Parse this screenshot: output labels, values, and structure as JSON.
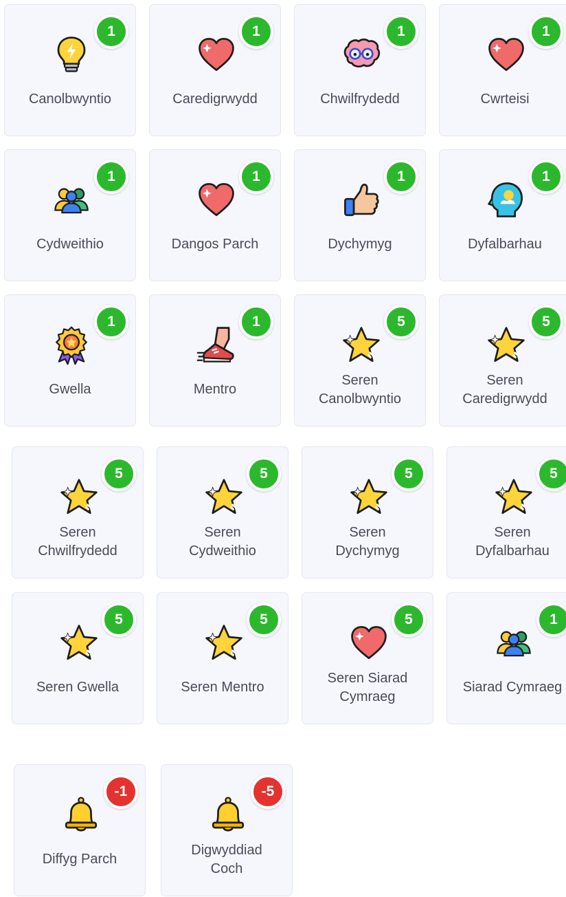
{
  "colors": {
    "positive_badge": "#2cb82c",
    "negative_badge": "#e4322f",
    "card_background": "#f6f7fc",
    "card_border": "#e4e6f0",
    "label_text": "#484c58"
  },
  "positive_skills": [
    {
      "label_lines": [
        "Canolbwyntio"
      ],
      "points": "1",
      "icon": "lightbulb-icon"
    },
    {
      "label_lines": [
        "Caredigrwydd"
      ],
      "points": "1",
      "icon": "heart-icon"
    },
    {
      "label_lines": [
        "Chwilfrydedd"
      ],
      "points": "1",
      "icon": "brain-with-glasses-icon"
    },
    {
      "label_lines": [
        "Cwrteisi"
      ],
      "points": "1",
      "icon": "heart-icon"
    },
    {
      "label_lines": [
        "Cydweithio"
      ],
      "points": "1",
      "icon": "people-group-icon"
    },
    {
      "label_lines": [
        "Dangos Parch"
      ],
      "points": "1",
      "icon": "heart-icon"
    },
    {
      "label_lines": [
        "Dychymyg"
      ],
      "points": "1",
      "icon": "thumbs-up-icon"
    },
    {
      "label_lines": [
        "Dyfalbarhau"
      ],
      "points": "1",
      "icon": "head-sunshine-icon"
    },
    {
      "label_lines": [
        "Gwella"
      ],
      "points": "1",
      "icon": "award-rosette-icon"
    },
    {
      "label_lines": [
        "Mentro"
      ],
      "points": "1",
      "icon": "running-shoe-icon"
    },
    {
      "label_lines": [
        "Seren",
        "Canolbwyntio"
      ],
      "points": "5",
      "icon": "star-icon"
    },
    {
      "label_lines": [
        "Seren",
        "Caredigrwydd"
      ],
      "points": "5",
      "icon": "star-icon"
    },
    {
      "label_lines": [
        "Seren",
        "Chwilfrydedd"
      ],
      "points": "5",
      "icon": "star-icon"
    },
    {
      "label_lines": [
        "Seren",
        "Cydweithio"
      ],
      "points": "5",
      "icon": "star-icon"
    },
    {
      "label_lines": [
        "Seren",
        "Dychymyg"
      ],
      "points": "5",
      "icon": "star-icon"
    },
    {
      "label_lines": [
        "Seren",
        "Dyfalbarhau"
      ],
      "points": "5",
      "icon": "star-icon"
    },
    {
      "label_lines": [
        "Seren Gwella"
      ],
      "points": "5",
      "icon": "star-icon"
    },
    {
      "label_lines": [
        "Seren Mentro"
      ],
      "points": "5",
      "icon": "star-icon"
    },
    {
      "label_lines": [
        "Seren Siarad",
        "Cymraeg"
      ],
      "points": "5",
      "icon": "heart-icon"
    },
    {
      "label_lines": [
        "Siarad Cymraeg"
      ],
      "points": "1",
      "icon": "people-group-icon"
    }
  ],
  "negative_skills": [
    {
      "label_lines": [
        "Diffyg Parch"
      ],
      "points": "-1",
      "icon": "bell-icon"
    },
    {
      "label_lines": [
        "Digwyddiad",
        "Coch"
      ],
      "points": "-5",
      "icon": "bell-icon"
    }
  ]
}
